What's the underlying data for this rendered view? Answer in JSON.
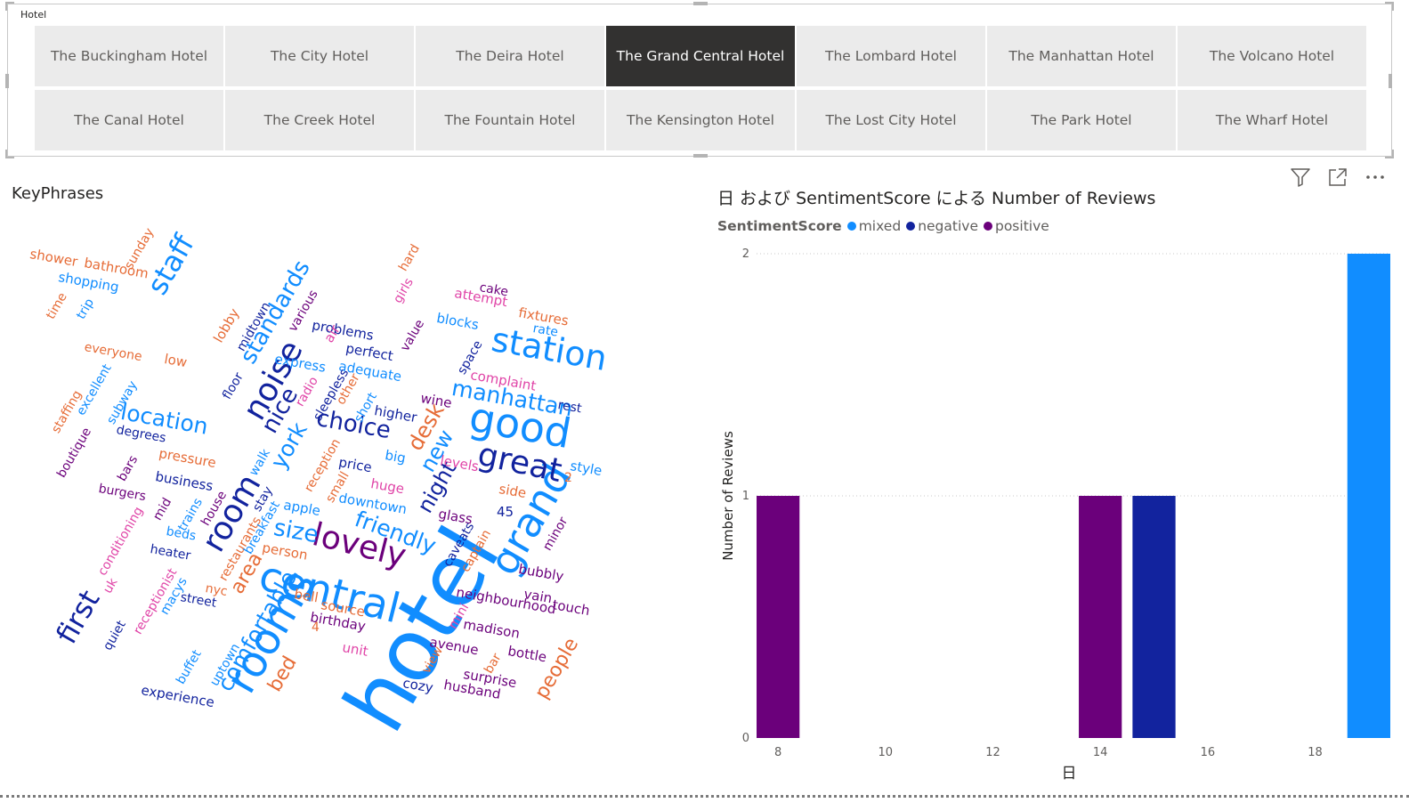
{
  "slicer": {
    "title": "Hotel",
    "tiles": [
      {
        "label": "The Buckingham Hotel",
        "selected": false
      },
      {
        "label": "The City Hotel",
        "selected": false
      },
      {
        "label": "The Deira Hotel",
        "selected": false
      },
      {
        "label": "The Grand Central Hotel",
        "selected": true
      },
      {
        "label": "The Lombard Hotel",
        "selected": false
      },
      {
        "label": "The Manhattan Hotel",
        "selected": false
      },
      {
        "label": "The Volcano Hotel",
        "selected": false
      },
      {
        "label": "The Canal Hotel",
        "selected": false
      },
      {
        "label": "The Creek Hotel",
        "selected": false
      },
      {
        "label": "The Fountain Hotel",
        "selected": false
      },
      {
        "label": "The Kensington Hotel",
        "selected": false
      },
      {
        "label": "The Lost City Hotel",
        "selected": false
      },
      {
        "label": "The Park Hotel",
        "selected": false
      },
      {
        "label": "The Wharf Hotel",
        "selected": false
      }
    ]
  },
  "wordcloud": {
    "title": "KeyPhrases",
    "words": [
      "hotel",
      "central",
      "rooms",
      "grand",
      "good",
      "great",
      "station",
      "lovely",
      "room",
      "noise",
      "standards",
      "manhattan",
      "staff",
      "first",
      "location",
      "choice",
      "friendly",
      "nice",
      "york",
      "comfortable",
      "size",
      "night",
      "new",
      "desk",
      "people",
      "area",
      "bed",
      "shower",
      "bathroom",
      "sunday",
      "shopping",
      "time",
      "trip",
      "everyone",
      "low",
      "lobby",
      "midtown",
      "various",
      "problems",
      "air",
      "perfect",
      "express",
      "adequate",
      "value",
      "blocks",
      "attempt",
      "cake",
      "fixtures",
      "rate",
      "space",
      "complaint",
      "rest",
      "wine",
      "higher",
      "short",
      "sleepless",
      "radio",
      "other",
      "floor",
      "excellent",
      "subway",
      "staffing",
      "boutique",
      "degrees",
      "pressure",
      "bars",
      "business",
      "burgers",
      "trains",
      "house",
      "mid",
      "conditioning",
      "beds",
      "heater",
      "uk",
      "receptionist",
      "macys",
      "street",
      "nyc",
      "restaurants",
      "stay",
      "breakfast",
      "walk",
      "reception",
      "small",
      "price",
      "big",
      "levels",
      "style",
      "2",
      "huge",
      "downtown",
      "apple",
      "glass",
      "45",
      "side",
      "caveats",
      "captain",
      "minor",
      "bubbly",
      "person",
      "bell",
      "source",
      "birthday",
      "4",
      "unit",
      "mini",
      "view",
      "avenue",
      "madison",
      "neighbourhood",
      "vain",
      "touch",
      "bottle",
      "bar",
      "surprise",
      "husband",
      "cozy",
      "buffet",
      "uptown",
      "experience",
      "quiet",
      "hard",
      "girls"
    ],
    "colors": {
      "orange": "#e66c37",
      "lightblue": "#118dff",
      "navy": "#12239e",
      "purple": "#6b007b",
      "magenta": "#e044a7",
      "violet": "#744ec2"
    }
  },
  "chart": {
    "title": "日 および SentimentScore による Number of Reviews",
    "legend_title": "SentimentScore",
    "icons": [
      "filter-icon",
      "focus-mode-icon",
      "more-options-icon"
    ]
  },
  "chart_data": {
    "type": "bar",
    "title": "日 および SentimentScore による Number of Reviews",
    "xlabel": "日",
    "ylabel": "Number of Reviews",
    "xlim": [
      7.6,
      19.4
    ],
    "x_ticks": [
      8,
      10,
      12,
      14,
      16,
      18
    ],
    "ylim": [
      0,
      2
    ],
    "y_ticks": [
      0,
      1,
      2
    ],
    "grid": true,
    "legend_position": "top-left",
    "series": [
      {
        "name": "mixed",
        "color": "#118dff",
        "points": [
          {
            "x": 19,
            "y": 2
          }
        ]
      },
      {
        "name": "negative",
        "color": "#12239e",
        "points": [
          {
            "x": 15,
            "y": 1
          }
        ]
      },
      {
        "name": "positive",
        "color": "#6b007b",
        "points": [
          {
            "x": 8,
            "y": 1
          },
          {
            "x": 14,
            "y": 1
          }
        ]
      }
    ]
  }
}
